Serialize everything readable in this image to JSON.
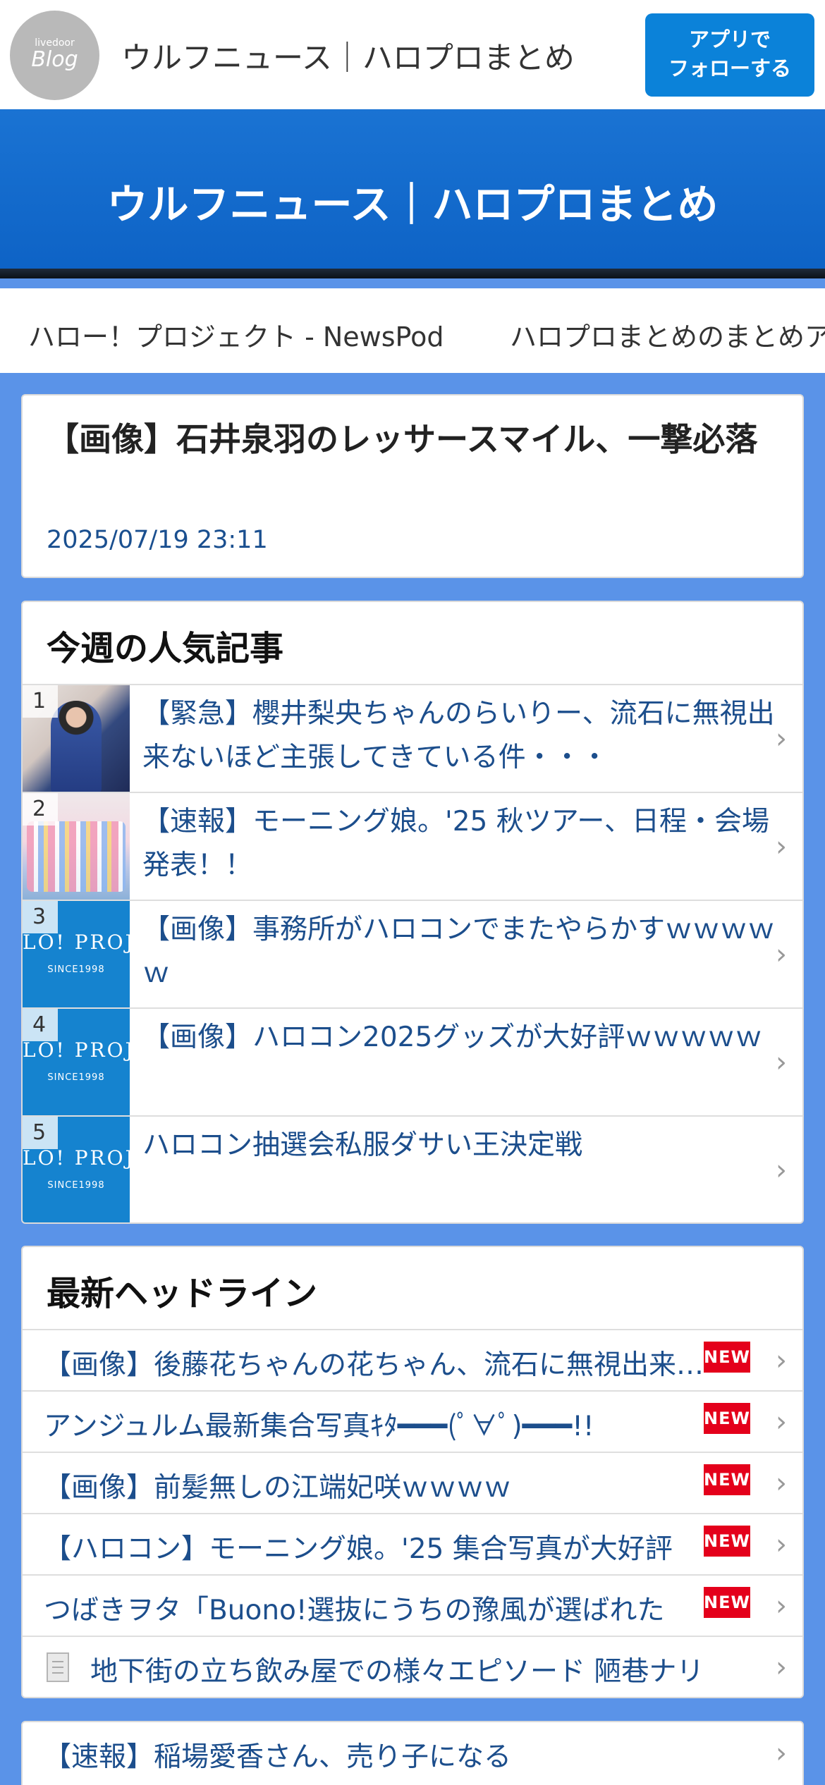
{
  "header": {
    "logo_small": "livedoor",
    "logo_big": "Blog",
    "site_name": "ウルフニュース｜ハロプロまとめ",
    "follow_button": [
      "アプリで",
      "フォローする"
    ]
  },
  "hero": {
    "title": "ウルフニュース｜ハロプロまとめ"
  },
  "tags": [
    "ハロー！プロジェクト - NewsPod",
    "ハロプロまとめのまとめア"
  ],
  "article": {
    "title": "【画像】石井泉羽のレッサースマイル、一撃必落",
    "date": "2025/07/19 23:11"
  },
  "popular": {
    "title": "今週の人気記事",
    "items": [
      {
        "rank": "1",
        "text": "【緊急】櫻井梨央ちゃんのらいりー、流石に無視出来ないほど主張してきている件・・・",
        "thumb": "photo-portrait"
      },
      {
        "rank": "2",
        "text": "【速報】モーニング娘。'25 秋ツアー、日程・会場発表！！",
        "thumb": "photo-group"
      },
      {
        "rank": "3",
        "text": "【画像】事務所がハロコンでまたやらかすｗｗｗｗｗ",
        "thumb": "logo",
        "thumb_text": "LO! PROJ",
        "thumb_sub": "SINCE1998"
      },
      {
        "rank": "4",
        "text": "【画像】ハロコン2025グッズが大好評ｗｗｗｗｗ",
        "thumb": "logo",
        "thumb_text": "LO! PROJ",
        "thumb_sub": "SINCE1998"
      },
      {
        "rank": "5",
        "text": "ハロコン抽選会私服ダサい王決定戦",
        "thumb": "logo",
        "thumb_text": "LO! PROJ",
        "thumb_sub": "SINCE1998"
      }
    ]
  },
  "headlines": {
    "title": "最新ヘッドライン",
    "new_label": "NEW",
    "items": [
      {
        "text": "【画像】後藤花ちゃんの花ちゃん、流石に無視出来ない",
        "new": true
      },
      {
        "text": "アンジュルム最新集合写真ｷﾀ━━━(ﾟ∀ﾟ)━━━!!",
        "new": true
      },
      {
        "text": "【画像】前髪無しの江端妃咲ｗｗｗｗ",
        "new": true
      },
      {
        "text": "【ハロコン】モーニング娘。'25 集合写真が大好評",
        "new": true
      },
      {
        "text": "つばきヲタ「Buono!選抜にうちの豫風が選ばれた",
        "new": true
      },
      {
        "text": "地下街の立ち飲み屋での様々エピソード 陋巷ナリ",
        "new": false,
        "icon": "document-icon"
      }
    ]
  },
  "bottom_item": {
    "text": "【速報】稲場愛香さん、売り子になる"
  }
}
